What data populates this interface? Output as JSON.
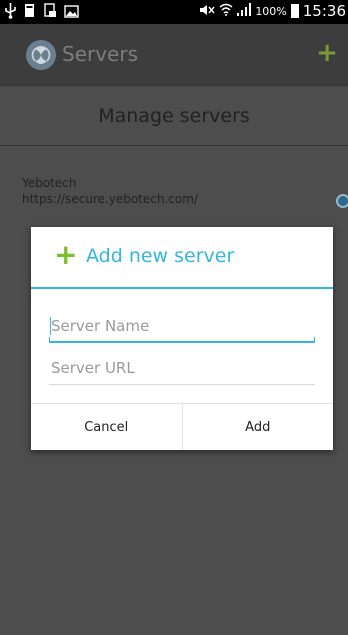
{
  "status_bar": {
    "battery": "100%",
    "time": "15:36"
  },
  "action_bar": {
    "title": "Servers",
    "add_symbol": "+"
  },
  "screen": {
    "heading": "Manage servers",
    "servers": [
      {
        "name": "Yebotech",
        "url": "https://secure.yebotech.com/",
        "selected": true
      }
    ]
  },
  "dialog": {
    "icon": "+",
    "title": "Add new server",
    "fields": {
      "name_placeholder": "Server Name",
      "url_placeholder": "Server URL"
    },
    "buttons": {
      "cancel": "Cancel",
      "add": "Add"
    }
  },
  "colors": {
    "accent": "#33b5e5",
    "plus_green": "#7bbf2b"
  }
}
